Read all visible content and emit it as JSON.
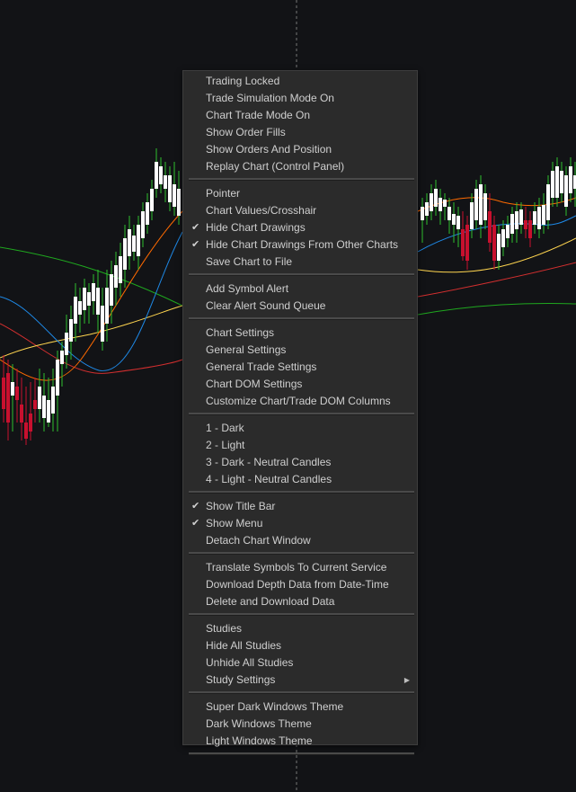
{
  "colors": {
    "background": "#121316",
    "bull_candle": "#ffffff",
    "bull_wick": "#2fbf2f",
    "bear_candle": "#c8102e",
    "ma_orange": "#ff6a00",
    "ma_blue": "#1e88e5",
    "ma_yellow": "#ffd54f",
    "ma_red": "#d32f2f",
    "ma_green": "#1fa81f",
    "crosshair": "#777777",
    "menu_bg": "#2b2b2b",
    "menu_text": "#cfcfcf"
  },
  "menu": {
    "groups": [
      [
        {
          "label": "Trading Locked"
        },
        {
          "label": "Trade Simulation Mode On"
        },
        {
          "label": "Chart Trade Mode On"
        },
        {
          "label": "Show Order Fills"
        },
        {
          "label": "Show Orders And Position"
        },
        {
          "label": "Replay Chart (Control Panel)"
        }
      ],
      [
        {
          "label": "Pointer"
        },
        {
          "label": "Chart Values/Crosshair"
        },
        {
          "label": "Hide Chart Drawings",
          "checked": true
        },
        {
          "label": "Hide Chart Drawings From Other Charts",
          "checked": true
        },
        {
          "label": "Save Chart to File"
        }
      ],
      [
        {
          "label": "Add Symbol Alert"
        },
        {
          "label": "Clear Alert Sound Queue"
        }
      ],
      [
        {
          "label": "Chart Settings"
        },
        {
          "label": "General Settings"
        },
        {
          "label": "General Trade Settings"
        },
        {
          "label": "Chart DOM Settings"
        },
        {
          "label": "Customize Chart/Trade DOM Columns"
        }
      ],
      [
        {
          "label": "1 - Dark"
        },
        {
          "label": "2 - Light"
        },
        {
          "label": "3 - Dark - Neutral Candles"
        },
        {
          "label": "4 - Light - Neutral Candles"
        }
      ],
      [
        {
          "label": "Show Title Bar",
          "checked": true
        },
        {
          "label": "Show Menu",
          "checked": true
        },
        {
          "label": "Detach Chart Window"
        }
      ],
      [
        {
          "label": "Translate Symbols To Current Service"
        },
        {
          "label": "Download Depth Data from Date-Time"
        },
        {
          "label": "Delete and Download Data"
        }
      ],
      [
        {
          "label": "Studies"
        },
        {
          "label": "Hide All Studies"
        },
        {
          "label": "Unhide All Studies"
        },
        {
          "label": "Study Settings",
          "submenu": true
        }
      ],
      [
        {
          "label": "Super Dark Windows Theme"
        },
        {
          "label": "Dark Windows Theme"
        },
        {
          "label": "Light Windows Theme"
        }
      ]
    ]
  },
  "icons": {
    "check": "check-icon",
    "submenu": "chevron-right-icon"
  }
}
